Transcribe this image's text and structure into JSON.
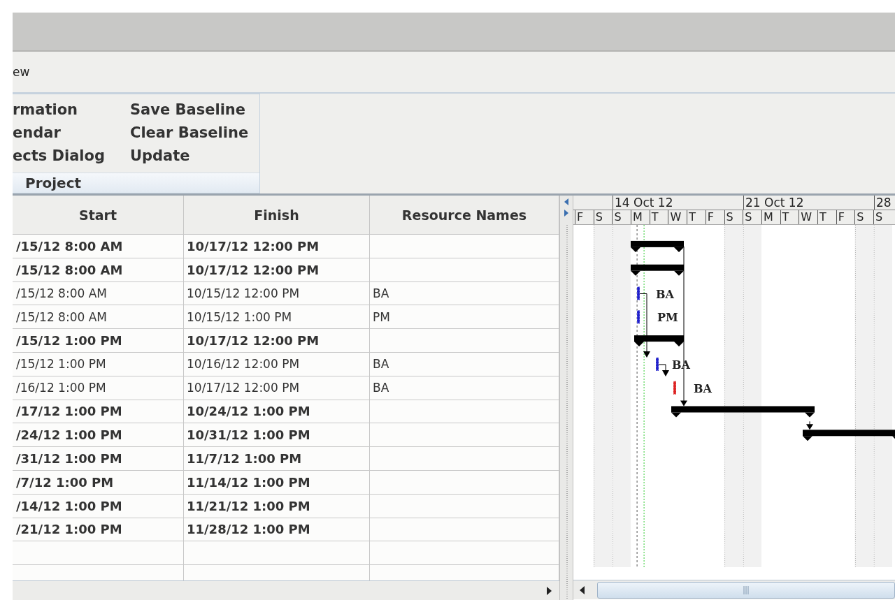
{
  "menu": {
    "items": [
      "ew"
    ]
  },
  "ribbon": {
    "groups": [
      {
        "label": "Project",
        "columns": [
          [
            "rmation",
            "endar",
            "ects Dialog"
          ],
          [
            "Save Baseline",
            "Clear Baseline",
            "Update"
          ]
        ]
      }
    ]
  },
  "table": {
    "columns": [
      "Start",
      "Finish",
      "Resource Names"
    ],
    "rows": [
      {
        "kind": "summary",
        "start": "/15/12 8:00 AM",
        "finish": "10/17/12 12:00 PM",
        "resources": ""
      },
      {
        "kind": "summary",
        "start": "/15/12 8:00 AM",
        "finish": "10/17/12 12:00 PM",
        "resources": ""
      },
      {
        "kind": "task",
        "start": "/15/12 8:00 AM",
        "finish": "10/15/12 12:00 PM",
        "resources": "BA"
      },
      {
        "kind": "task",
        "start": "/15/12 8:00 AM",
        "finish": "10/15/12 1:00 PM",
        "resources": "PM"
      },
      {
        "kind": "summary",
        "start": "/15/12 1:00 PM",
        "finish": "10/17/12 12:00 PM",
        "resources": ""
      },
      {
        "kind": "task",
        "start": "/15/12 1:00 PM",
        "finish": "10/16/12 12:00 PM",
        "resources": "BA"
      },
      {
        "kind": "task",
        "start": "/16/12 1:00 PM",
        "finish": "10/17/12 12:00 PM",
        "resources": "BA"
      },
      {
        "kind": "summary",
        "start": "/17/12 1:00 PM",
        "finish": "10/24/12 1:00 PM",
        "resources": ""
      },
      {
        "kind": "summary",
        "start": "/24/12 1:00 PM",
        "finish": "10/31/12 1:00 PM",
        "resources": ""
      },
      {
        "kind": "summary",
        "start": "/31/12 1:00 PM",
        "finish": "11/7/12 1:00 PM",
        "resources": ""
      },
      {
        "kind": "summary",
        "start": "/7/12 1:00 PM",
        "finish": "11/14/12 1:00 PM",
        "resources": ""
      },
      {
        "kind": "summary",
        "start": "/14/12 1:00 PM",
        "finish": "11/21/12 1:00 PM",
        "resources": ""
      },
      {
        "kind": "summary",
        "start": "/21/12 1:00 PM",
        "finish": "11/28/12 1:00 PM",
        "resources": ""
      }
    ]
  },
  "gantt": {
    "weeks": [
      "14 Oct 12",
      "21 Oct 12",
      "28"
    ],
    "days": [
      "F",
      "S",
      "S",
      "M",
      "T",
      "W",
      "T",
      "F",
      "S",
      "S",
      "M",
      "T",
      "W",
      "T",
      "F",
      "S",
      "S"
    ],
    "bar_labels": [
      "BA",
      "PM",
      "BA",
      "BA"
    ]
  }
}
